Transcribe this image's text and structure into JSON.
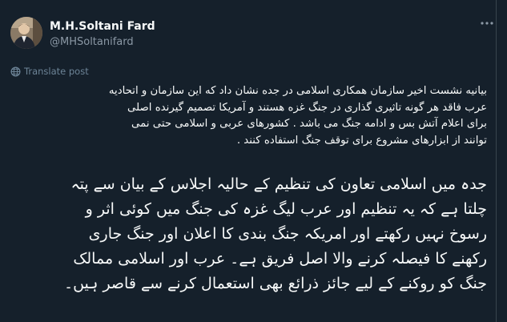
{
  "author": {
    "name": "M.H.Soltani Fard",
    "handle": "@MHSoltanifard",
    "avatar_icon": "profile-photo-icon"
  },
  "actions": {
    "more_icon": "more-horizontal-icon"
  },
  "translate": {
    "label": "Translate post",
    "icon": "globe-icon"
  },
  "post": {
    "persian_lines": [
      "بیانیه نشست اخیر سازمان همکاری اسلامی در جده نشان داد که این سازمان و اتحادیه",
      "عرب فاقد هر گونه تاثیری گذاری در جنگ غزه هستند و آمریکا تصمیم گیرنده اصلی",
      "برای اعلام آتش بس و ادامه جنگ می باشد . کشورهای عربی و اسلامی حتی نمی",
      "توانند از ابزارهای مشروع برای توقف جنگ استفاده کنند ."
    ],
    "urdu_lines": [
      "جدہ میں اسلامی تعاون کی تنظیم کے حالیہ اجلاس کے بیان سے پتہ",
      "چلتا ہے کہ یہ تنظیم اور عرب لیگ غزہ کی جنگ میں کوئی اثر و",
      "رسوخ نہیں رکھتے اور امریکہ جنگ بندی کا اعلان اور جنگ جاری",
      "رکھنے کا فیصلہ کرنے والا اصل فریق ہے۔ عرب اور اسلامی ممالک",
      "جنگ کو روکنے کے لیے جائز ذرائع بھی استعمال کرنے سے قاصر ہیں۔"
    ]
  },
  "colors": {
    "background": "#15202b",
    "text": "#f7f9f9",
    "secondary": "#8b98a5",
    "translate_link": "#6d8497"
  }
}
